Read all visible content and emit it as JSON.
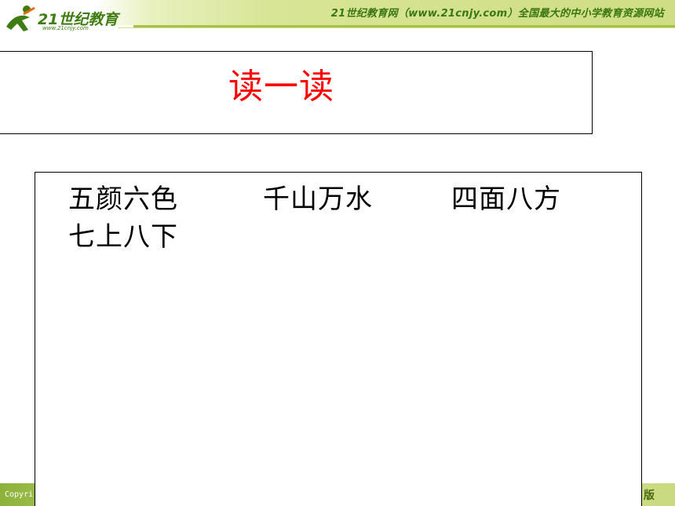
{
  "header": {
    "logo_text": "21世纪教育",
    "logo_url": "www.21cnjy.com",
    "site_text": "21世纪教育网（www.21cnjy.com）全国最大的中小学教育资源网站"
  },
  "slide": {
    "title": "读一读",
    "phrases": [
      "五颜六色",
      "千山万水",
      "四面八方",
      "七上八下"
    ]
  },
  "footer": {
    "left_text": "Copyri",
    "right_text": "版"
  },
  "colors": {
    "title": "#ff0000",
    "brand_green": "#3f7d12",
    "banner_green": "#cfdd84",
    "footer_green": "#8db23a"
  }
}
